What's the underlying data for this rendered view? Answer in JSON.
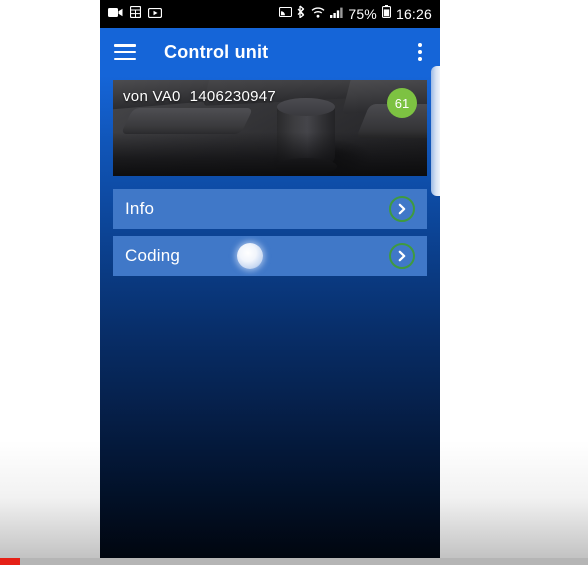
{
  "status_bar": {
    "left_icons": [
      "video-camera-icon",
      "grid-app-icon",
      "media-player-icon"
    ],
    "right_icons": [
      "screen-cast-icon",
      "bluetooth-icon",
      "wifi-icon",
      "cellular-signal-icon",
      "battery-icon"
    ],
    "battery_percent": "75%",
    "clock": "16:26"
  },
  "app_bar": {
    "menu_icon": "hamburger-menu-icon",
    "title": "Control unit",
    "overflow_icon": "overflow-menu-icon"
  },
  "hero": {
    "label": "von VA0  1406230947",
    "badge": "61",
    "badge_color": "#7DC242",
    "image_alt": "control-unit-device-photo"
  },
  "rows": [
    {
      "label": "Info",
      "arrow_icon": "chevron-right-circle-icon"
    },
    {
      "label": "Coding",
      "arrow_icon": "chevron-right-circle-icon"
    }
  ],
  "colors": {
    "app_bar": "#1565D8",
    "row_background": "#4078c8",
    "arrow_ring": "#3f9a3f",
    "badge_green": "#7DC242",
    "progress_red": "#e62117"
  }
}
